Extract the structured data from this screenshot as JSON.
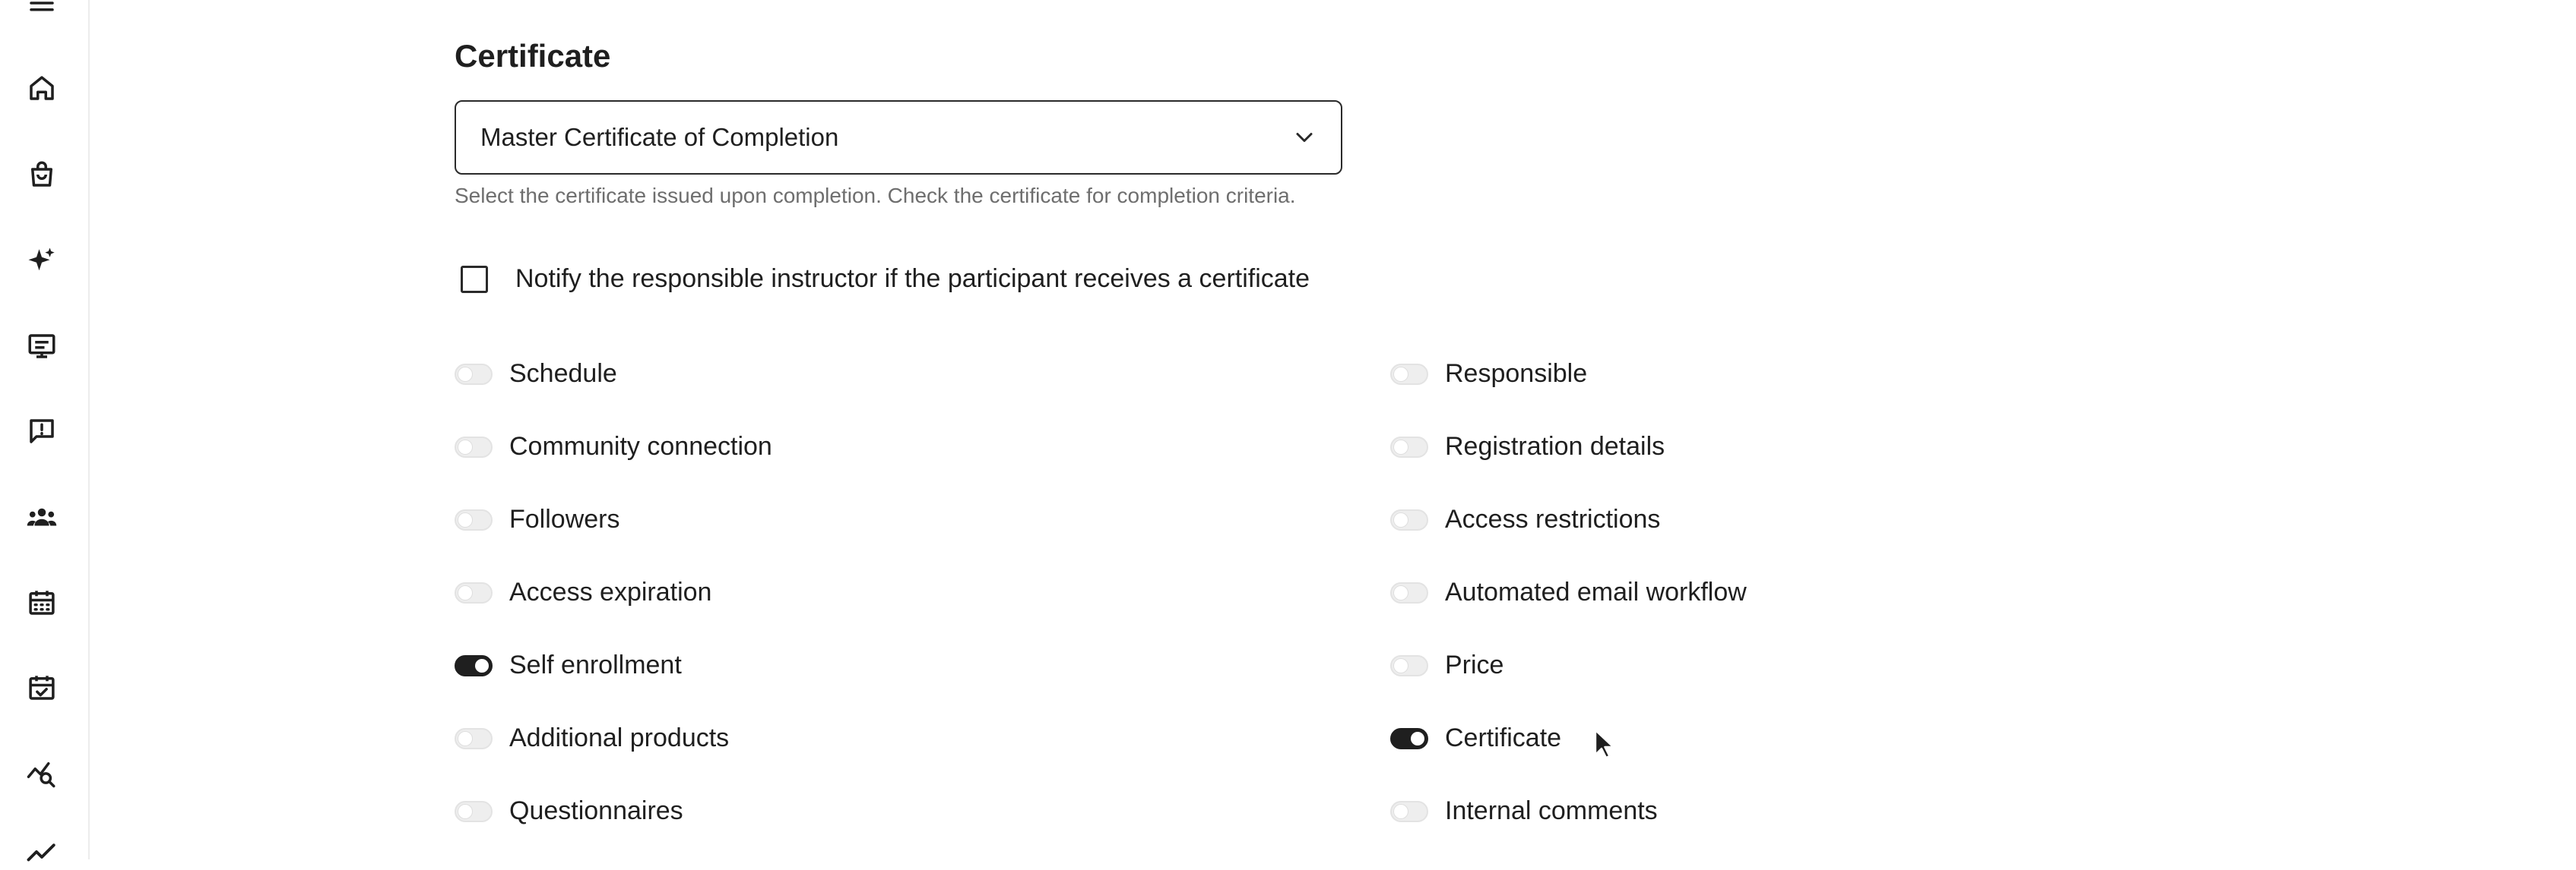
{
  "sidebar": {
    "icons": [
      "menu-icon",
      "home-icon",
      "shopping-bag-icon",
      "sparkles-icon",
      "presentation-icon",
      "feedback-icon",
      "users-icon",
      "calendar-icon",
      "calendar-check-icon",
      "analytics-search-icon",
      "trend-chart-icon"
    ]
  },
  "certificate": {
    "title": "Certificate",
    "select_value": "Master Certificate of Completion",
    "helper_text": "Select the certificate issued upon completion. Check the certificate for completion criteria.",
    "notify_label": "Notify the responsible instructor if the participant receives a certificate",
    "notify_checked": false
  },
  "toggles": {
    "left": [
      {
        "label": "Schedule",
        "on": false
      },
      {
        "label": "Community connection",
        "on": false
      },
      {
        "label": "Followers",
        "on": false
      },
      {
        "label": "Access expiration",
        "on": false
      },
      {
        "label": "Self enrollment",
        "on": true
      },
      {
        "label": "Additional products",
        "on": false
      },
      {
        "label": "Questionnaires",
        "on": false
      }
    ],
    "right": [
      {
        "label": "Responsible",
        "on": false
      },
      {
        "label": "Registration details",
        "on": false
      },
      {
        "label": "Access restrictions",
        "on": false
      },
      {
        "label": "Automated email workflow",
        "on": false
      },
      {
        "label": "Price",
        "on": false
      },
      {
        "label": "Certificate",
        "on": true
      },
      {
        "label": "Internal comments",
        "on": false
      }
    ]
  },
  "colors": {
    "toggle_on": "#1f1f1f",
    "toggle_off": "#eeeeee",
    "helper_text": "#6e6e6e"
  }
}
